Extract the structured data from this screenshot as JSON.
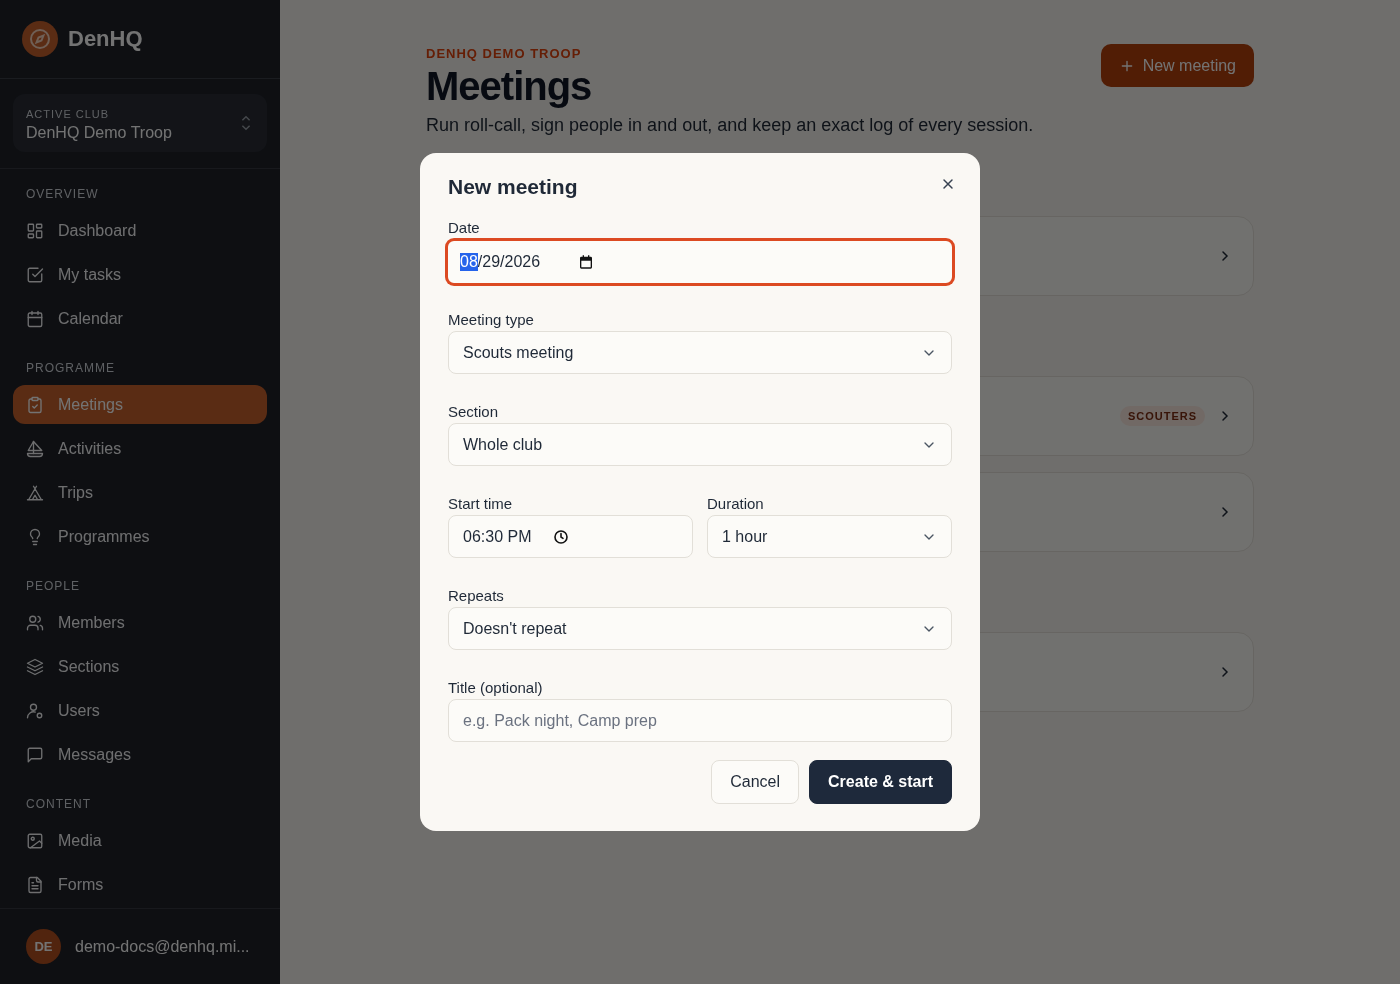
{
  "sidebar": {
    "brand": "DenHQ",
    "club": {
      "label": "ACTIVE CLUB",
      "name": "DenHQ Demo Troop"
    },
    "groups": [
      {
        "heading": "OVERVIEW",
        "items": [
          {
            "label": "Dashboard",
            "selected": false
          },
          {
            "label": "My tasks",
            "selected": false
          },
          {
            "label": "Calendar",
            "selected": false
          }
        ]
      },
      {
        "heading": "PROGRAMME",
        "items": [
          {
            "label": "Meetings",
            "selected": true
          },
          {
            "label": "Activities",
            "selected": false
          },
          {
            "label": "Trips",
            "selected": false
          },
          {
            "label": "Programmes",
            "selected": false
          }
        ]
      },
      {
        "heading": "PEOPLE",
        "items": [
          {
            "label": "Members",
            "selected": false
          },
          {
            "label": "Sections",
            "selected": false
          },
          {
            "label": "Users",
            "selected": false
          },
          {
            "label": "Messages",
            "selected": false
          }
        ]
      },
      {
        "heading": "CONTENT",
        "items": [
          {
            "label": "Media",
            "selected": false
          },
          {
            "label": "Forms",
            "selected": false
          }
        ]
      }
    ],
    "user": {
      "initials": "DE",
      "email": "demo-docs@denhq.mi..."
    }
  },
  "page": {
    "eyebrow": "DENHQ DEMO TROOP",
    "title": "Meetings",
    "subtitle": "Run roll-call, sign people in and out, and keep an exact log of every session.",
    "new_button": "New meeting",
    "cards": [
      {
        "group_start": true
      },
      {
        "group_start": true,
        "badge": "SCOUTERS"
      },
      {
        "group_start": false
      },
      {
        "group_start": true
      }
    ]
  },
  "dialog": {
    "title": "New meeting",
    "date": {
      "label": "Date",
      "focused": true,
      "segments": [
        {
          "text": "08",
          "selected": true
        },
        {
          "text": "/",
          "selected": false
        },
        {
          "text": "29",
          "selected": false
        },
        {
          "text": "/",
          "selected": false
        },
        {
          "text": "2026",
          "selected": false
        }
      ]
    },
    "meeting_type": {
      "label": "Meeting type",
      "value": "Scouts meeting"
    },
    "section": {
      "label": "Section",
      "value": "Whole club"
    },
    "start_time": {
      "label": "Start time",
      "value": "06:30 PM"
    },
    "duration": {
      "label": "Duration",
      "value": "1 hour"
    },
    "repeats": {
      "label": "Repeats",
      "value": "Doesn't repeat"
    },
    "title_field": {
      "label": "Title (optional)",
      "placeholder": "e.g. Pack night, Camp prep"
    },
    "buttons": {
      "cancel": "Cancel",
      "submit": "Create & start"
    }
  }
}
